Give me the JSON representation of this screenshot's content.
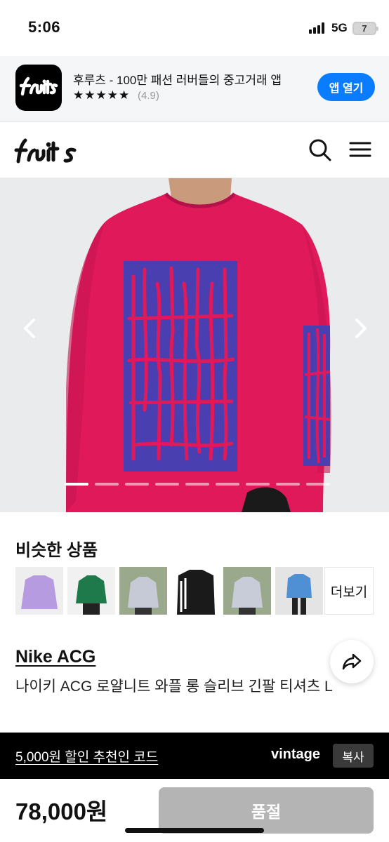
{
  "status_bar": {
    "time": "5:06",
    "network": "5G",
    "battery": "7"
  },
  "app_banner": {
    "name": "후루츠 - 100만 패션 러버들의 중고거래 앱",
    "stars": "★★★★★",
    "rating": "(4.9)",
    "open_label": "앱 열기"
  },
  "header": {
    "logo": "fruits",
    "icons": [
      "search-icon",
      "hamburger-menu-icon"
    ]
  },
  "gallery": {
    "image_count": 9,
    "active_index": 0,
    "colors": {
      "shirt": "#e0195a",
      "print": "#4a3fb0",
      "background": "#e9ebec"
    }
  },
  "similar": {
    "title": "비슷한 상품",
    "more_label": "더보기",
    "thumbnails": [
      {
        "color": "#b79be0"
      },
      {
        "color": "#1e7a4a"
      },
      {
        "color": "#c6cad6"
      },
      {
        "color": "#1a1a1a"
      },
      {
        "color": "#c8ccd8"
      },
      {
        "color": "#4f8fd4"
      }
    ]
  },
  "product": {
    "brand": "Nike ACG",
    "title": "나이키 ACG 로얄니트 와플 롱 슬리브 긴팔 티셔츠 L"
  },
  "promo": {
    "link_text": "5,000원 할인 추천인 코드",
    "code": "vintage",
    "copy_label": "복사"
  },
  "purchase": {
    "price": "78,000원",
    "button_label": "품절"
  }
}
